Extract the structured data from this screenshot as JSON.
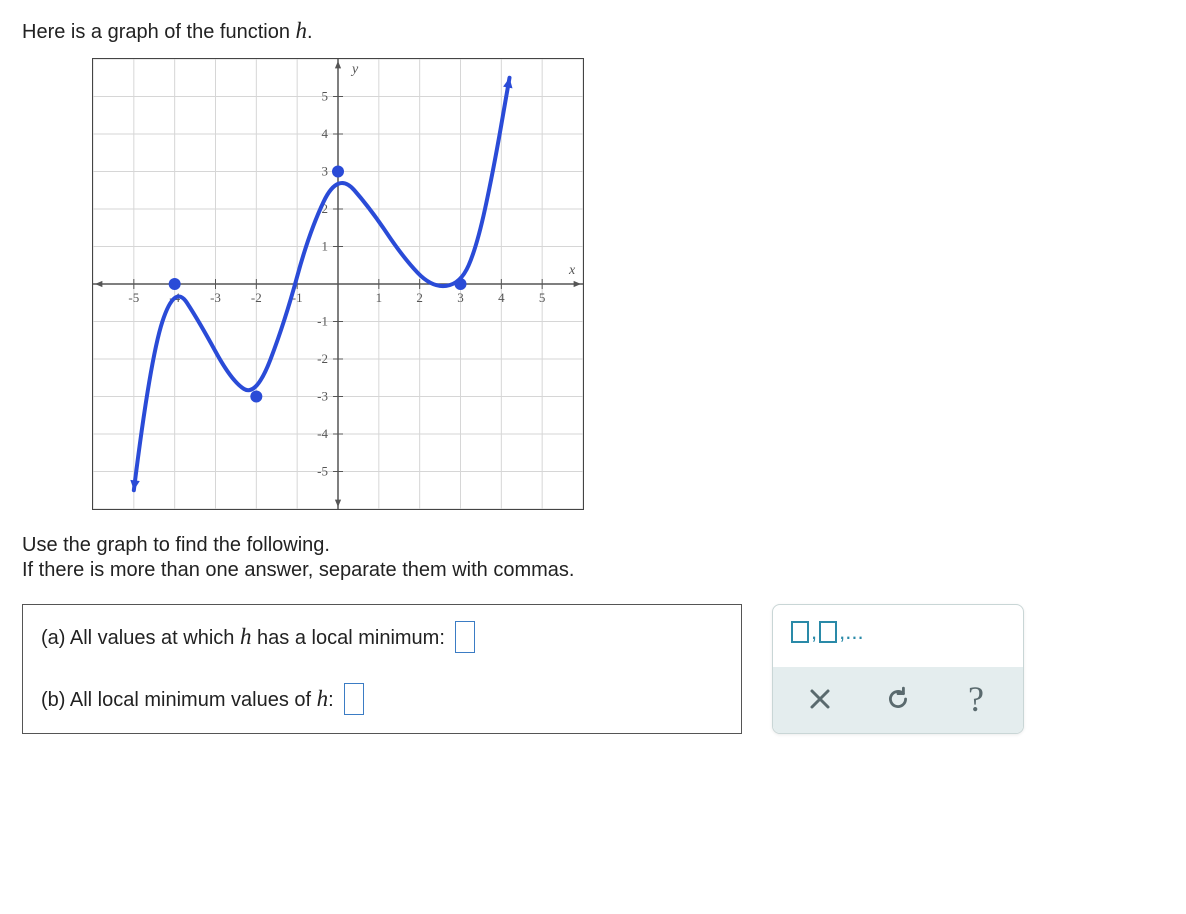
{
  "intro": {
    "prefix": "Here is a graph of the function ",
    "func": "h",
    "suffix": "."
  },
  "instructions": {
    "line1": "Use the graph to find the following.",
    "line2": "If there is more than one answer, separate them with commas."
  },
  "questions": {
    "a_prefix": "(a) All values at which ",
    "a_func": "h",
    "a_suffix": " has a local minimum: ",
    "b_prefix": "(b) All local minimum values of ",
    "b_func": "h",
    "b_suffix": ": "
  },
  "toolbox": {
    "list_hint_sep": ",",
    "list_hint_tail": ",..."
  },
  "chart_data": {
    "type": "line",
    "xlabel": "x",
    "ylabel": "y",
    "xlim": [
      -6,
      6
    ],
    "ylim": [
      -6,
      6
    ],
    "x_ticks": [
      -5,
      -4,
      -3,
      -2,
      -1,
      1,
      2,
      3,
      4,
      5
    ],
    "y_ticks": [
      -5,
      -4,
      -3,
      -2,
      -1,
      1,
      2,
      3,
      4,
      5
    ],
    "arrows": [
      "left",
      "right",
      "up",
      "down"
    ],
    "curve_points_xy": [
      [
        -5,
        -5.5
      ],
      [
        -4.6,
        -2
      ],
      [
        -4,
        0
      ],
      [
        -3.4,
        -1.0
      ],
      [
        -2.6,
        -2.6
      ],
      [
        -2,
        -3
      ],
      [
        -1.3,
        -1.0
      ],
      [
        -0.7,
        1.4
      ],
      [
        0,
        3
      ],
      [
        0.8,
        2.0
      ],
      [
        1.6,
        0.7
      ],
      [
        2.3,
        -0.1
      ],
      [
        3,
        0
      ],
      [
        3.4,
        1.0
      ],
      [
        3.8,
        3.0
      ],
      [
        4.2,
        5.5
      ]
    ],
    "marked_points_xy": [
      [
        -4,
        0
      ],
      [
        -2,
        -3
      ],
      [
        0,
        3
      ],
      [
        3,
        0
      ]
    ],
    "start_arrow": true,
    "end_arrow": true
  }
}
